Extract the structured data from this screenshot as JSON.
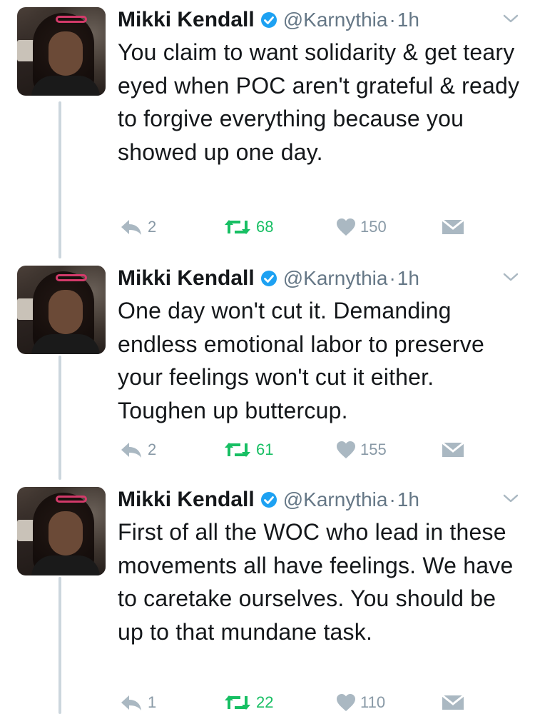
{
  "tweets": [
    {
      "author": {
        "name": "Mikki Kendall",
        "handle": "@Karnythia",
        "separator": "·",
        "time": "1h"
      },
      "text": "You claim to want solidarity & get teary eyed when POC aren't grateful & ready to forgive everything because you showed up one day.",
      "actions": {
        "replies": "2",
        "retweets": "68",
        "likes": "150"
      }
    },
    {
      "author": {
        "name": "Mikki Kendall",
        "handle": "@Karnythia",
        "separator": "·",
        "time": "1h"
      },
      "text": "One day won't cut it. Demanding endless emotional labor to preserve your feelings won't cut it either. Toughen up buttercup.",
      "actions": {
        "replies": "2",
        "retweets": "61",
        "likes": "155"
      }
    },
    {
      "author": {
        "name": "Mikki Kendall",
        "handle": "@Karnythia",
        "separator": "·",
        "time": "1h"
      },
      "text": "First of all the WOC who lead in these movements all have feelings. We have to caretake ourselves. You should be up to that mundane task.",
      "actions": {
        "replies": "1",
        "retweets": "22",
        "likes": "110"
      }
    }
  ],
  "icons": {
    "verified": "verified-badge-icon",
    "chevron": "chevron-down-icon",
    "reply": "reply-icon",
    "retweet": "retweet-icon",
    "like": "heart-icon",
    "dm": "envelope-icon"
  },
  "colors": {
    "name": "#14171a",
    "meta": "#657786",
    "verified": "#1da1f2",
    "retweet_active": "#17bf63",
    "icon_grey": "#aab8c2",
    "thread_line": "#ccd6dd"
  }
}
